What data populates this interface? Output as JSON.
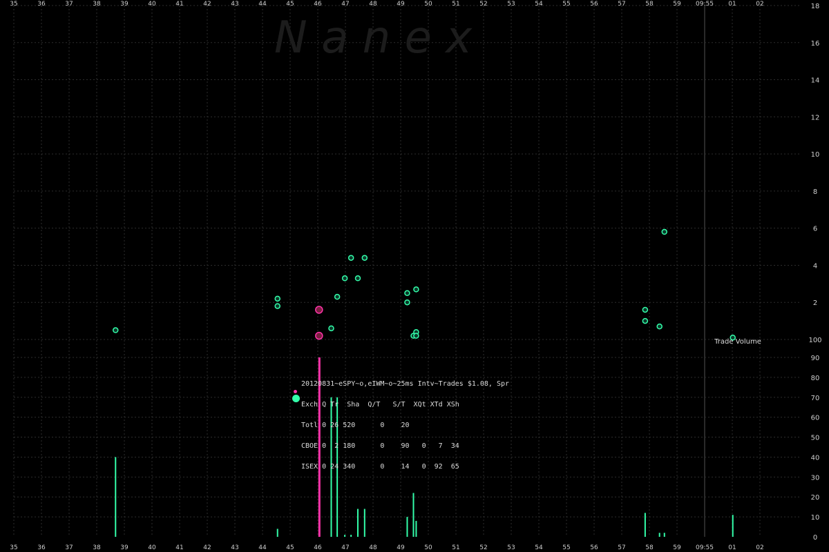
{
  "chart_data": {
    "type": "scatter",
    "watermark": "N a n e x",
    "x_tick_labels": [
      "35",
      "36",
      "37",
      "38",
      "39",
      "40",
      "41",
      "42",
      "43",
      "44",
      "45",
      "46",
      "47",
      "48",
      "49",
      "50",
      "51",
      "52",
      "53",
      "54",
      "55",
      "56",
      "57",
      "58",
      "59",
      "09:55",
      "01",
      "02"
    ],
    "time_label": "09:55",
    "x_range": [
      35,
      62.5
    ],
    "price_axis": {
      "range": [
        0.75,
        1.18
      ],
      "tick_labels": [
        "100",
        "2",
        "4",
        "6",
        "8",
        "10",
        "12",
        "14",
        "16",
        "18"
      ],
      "tick_values": [
        1.0,
        1.02,
        1.04,
        1.06,
        1.08,
        1.1,
        1.12,
        1.14,
        1.16,
        1.18
      ]
    },
    "volume_axis": {
      "label": "Trade Volume",
      "range": [
        0,
        90
      ],
      "tick_labels": [
        "0",
        "10",
        "20",
        "30",
        "40",
        "50",
        "60",
        "70",
        "80",
        "90"
      ]
    },
    "series": [
      {
        "name": "CBOE",
        "color": "#ff33aa",
        "trades": [
          {
            "x": 46.25,
            "price": 1.016
          },
          {
            "x": 46.25,
            "price": 1.002
          }
        ]
      },
      {
        "name": "ISEX",
        "color": "#33ffaa",
        "trades": [
          {
            "x": 38.75,
            "price": 1.005
          },
          {
            "x": 44.72,
            "price": 1.022
          },
          {
            "x": 44.72,
            "price": 1.018
          },
          {
            "x": 46.7,
            "price": 1.006
          },
          {
            "x": 46.92,
            "price": 1.023
          },
          {
            "x": 47.2,
            "price": 1.033
          },
          {
            "x": 47.43,
            "price": 1.044
          },
          {
            "x": 47.68,
            "price": 1.033
          },
          {
            "x": 47.93,
            "price": 1.044
          },
          {
            "x": 49.5,
            "price": 1.025
          },
          {
            "x": 49.5,
            "price": 1.02
          },
          {
            "x": 49.73,
            "price": 1.002
          },
          {
            "x": 49.83,
            "price": 1.004
          },
          {
            "x": 49.83,
            "price": 1.002
          },
          {
            "x": 49.83,
            "price": 1.027
          },
          {
            "x": 58.27,
            "price": 1.016
          },
          {
            "x": 58.27,
            "price": 1.01
          },
          {
            "x": 58.8,
            "price": 1.007
          },
          {
            "x": 58.98,
            "price": 1.058
          },
          {
            "x": 61.5,
            "price": 1.001
          }
        ]
      }
    ],
    "volume_bars": [
      {
        "x": 38.75,
        "volume": 40,
        "exchange": "ISEX"
      },
      {
        "x": 44.72,
        "volume": 4,
        "exchange": "ISEX"
      },
      {
        "x": 46.25,
        "volume": 90,
        "exchange": "CBOE"
      },
      {
        "x": 46.7,
        "volume": 70,
        "exchange": "ISEX"
      },
      {
        "x": 46.92,
        "volume": 70,
        "exchange": "ISEX"
      },
      {
        "x": 47.2,
        "volume": 1,
        "exchange": "ISEX"
      },
      {
        "x": 47.43,
        "volume": 1,
        "exchange": "ISEX"
      },
      {
        "x": 47.68,
        "volume": 14,
        "exchange": "ISEX"
      },
      {
        "x": 47.93,
        "volume": 14,
        "exchange": "ISEX"
      },
      {
        "x": 49.5,
        "volume": 10,
        "exchange": "ISEX"
      },
      {
        "x": 49.73,
        "volume": 22,
        "exchange": "ISEX"
      },
      {
        "x": 49.83,
        "volume": 8,
        "exchange": "ISEX"
      },
      {
        "x": 58.27,
        "volume": 12,
        "exchange": "ISEX"
      },
      {
        "x": 58.8,
        "volume": 2,
        "exchange": "ISEX"
      },
      {
        "x": 58.98,
        "volume": 2,
        "exchange": "ISEX"
      },
      {
        "x": 61.5,
        "volume": 11,
        "exchange": "ISEX"
      }
    ],
    "summary_table": {
      "title": "20120831~eSPY~o,eIWM~o~25ms Intv~Trades $1.08, Spr",
      "header": "Exch Q Tr  Sha  Q/T   S/T  XQt XTd XSh",
      "rows": [
        {
          "text": "Totl 0 26 520      0    20",
          "marker": null
        },
        {
          "text": "CBOE 0  2 180      0    90   0   7  34",
          "marker": "CBOE"
        },
        {
          "text": "ISEX 0 24 340      0    14   0  92  65",
          "marker": "ISEX"
        }
      ]
    },
    "grid": true
  }
}
